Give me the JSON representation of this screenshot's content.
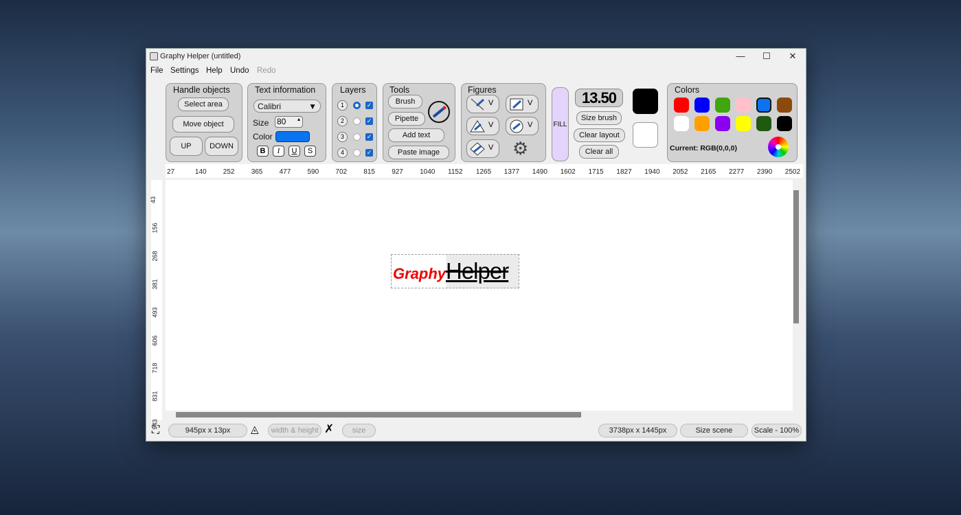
{
  "window": {
    "title": "Graphy Helper (untitled)",
    "minimize": "—",
    "maximize": "☐",
    "close": "✕"
  },
  "menu": [
    "File",
    "Settings",
    "Help",
    "Undo",
    "Redo"
  ],
  "handle_objects": {
    "title": "Handle objects",
    "select_area": "Select area",
    "move_object": "Move object",
    "up": "UP",
    "down": "DOWN"
  },
  "text_info": {
    "title": "Text information",
    "font": "Calibri",
    "size_label": "Size",
    "size": "80",
    "color_label": "Color",
    "color": "#0a74f0",
    "bold": "B",
    "italic": "I",
    "underline": "U",
    "strike": "S"
  },
  "layers": {
    "title": "Layers",
    "items": [
      {
        "n": "1",
        "active": true,
        "visible": true
      },
      {
        "n": "2",
        "active": false,
        "visible": true
      },
      {
        "n": "3",
        "active": false,
        "visible": true
      },
      {
        "n": "4",
        "active": false,
        "visible": true
      }
    ]
  },
  "tools": {
    "title": "Tools",
    "brush": "Brush",
    "pipette": "Pipette",
    "add_text": "Add text",
    "paste_image": "Paste image"
  },
  "figures": {
    "title": "Figures",
    "dropdown": "V"
  },
  "fill_label": "FILL",
  "brush_size": "13.50",
  "size_brush": "Size brush",
  "clear_layout": "Clear layout",
  "clear_all": "Clear all",
  "primary_color": "#000000",
  "secondary_color": "#ffffff",
  "colors": {
    "title": "Colors",
    "swatches": [
      "#ff0000",
      "#0000ff",
      "#3fa60f",
      "#ffc0cb",
      "#0a74f0",
      "#8b4a0b",
      "#ffffff",
      "#ffa000",
      "#8a00f0",
      "#ffff00",
      "#1f5a10",
      "#000000"
    ],
    "selected": 4,
    "current": "Current: RGB(0,0,0)"
  },
  "ruler_h": [
    "27",
    "140",
    "252",
    "365",
    "477",
    "590",
    "702",
    "815",
    "927",
    "1040",
    "1152",
    "1265",
    "1377",
    "1490",
    "1602",
    "1715",
    "1827",
    "1940",
    "2052",
    "2165",
    "2277",
    "2390",
    "2502"
  ],
  "ruler_v": [
    "43",
    "156",
    "268",
    "381",
    "493",
    "606",
    "718",
    "831",
    "943"
  ],
  "canvas_text": {
    "part1": "Graphy",
    "part2": "Helper"
  },
  "status": {
    "cursor": "945px x 13px",
    "width_height": "width & height",
    "size": "size",
    "scene": "3738px x 1445px",
    "size_scene": "Size scene",
    "scale": "Scale - 100%"
  }
}
